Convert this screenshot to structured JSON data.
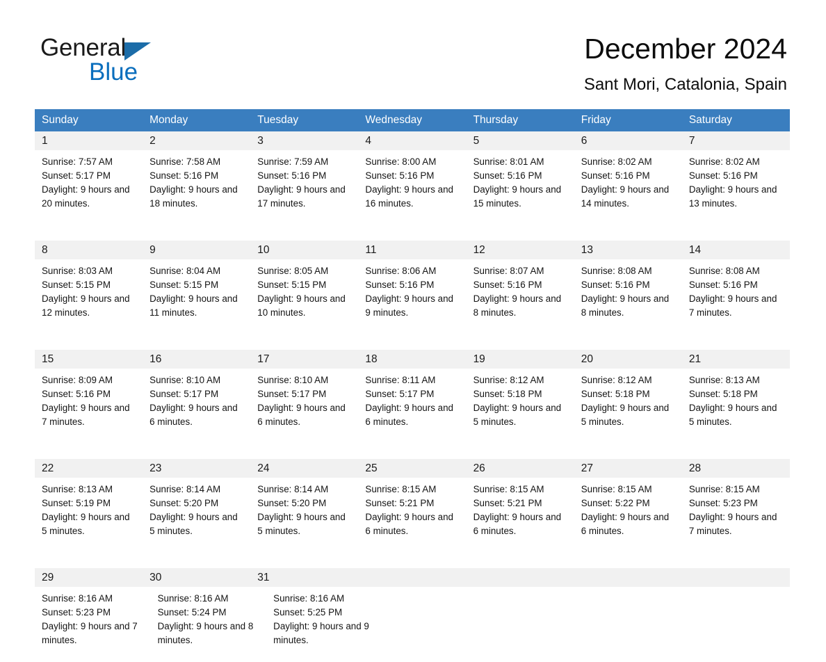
{
  "brand": {
    "line1": "General",
    "line2": "Blue",
    "triangle_color": "#1b6ca8",
    "blue_color": "#0a6ebd"
  },
  "header": {
    "title": "December 2024",
    "subtitle": "Sant Mori, Catalonia, Spain"
  },
  "theme": {
    "header_blue": "#3a7ebf",
    "daynum_gray": "#f1f1f1",
    "separator_blue": "#3a7ebf"
  },
  "weekdays": [
    "Sunday",
    "Monday",
    "Tuesday",
    "Wednesday",
    "Thursday",
    "Friday",
    "Saturday"
  ],
  "weeks": [
    {
      "days": [
        {
          "num": "1",
          "sunrise": "Sunrise: 7:57 AM",
          "sunset": "Sunset: 5:17 PM",
          "daylight": "Daylight: 9 hours and 20 minutes."
        },
        {
          "num": "2",
          "sunrise": "Sunrise: 7:58 AM",
          "sunset": "Sunset: 5:16 PM",
          "daylight": "Daylight: 9 hours and 18 minutes."
        },
        {
          "num": "3",
          "sunrise": "Sunrise: 7:59 AM",
          "sunset": "Sunset: 5:16 PM",
          "daylight": "Daylight: 9 hours and 17 minutes."
        },
        {
          "num": "4",
          "sunrise": "Sunrise: 8:00 AM",
          "sunset": "Sunset: 5:16 PM",
          "daylight": "Daylight: 9 hours and 16 minutes."
        },
        {
          "num": "5",
          "sunrise": "Sunrise: 8:01 AM",
          "sunset": "Sunset: 5:16 PM",
          "daylight": "Daylight: 9 hours and 15 minutes."
        },
        {
          "num": "6",
          "sunrise": "Sunrise: 8:02 AM",
          "sunset": "Sunset: 5:16 PM",
          "daylight": "Daylight: 9 hours and 14 minutes."
        },
        {
          "num": "7",
          "sunrise": "Sunrise: 8:02 AM",
          "sunset": "Sunset: 5:16 PM",
          "daylight": "Daylight: 9 hours and 13 minutes."
        }
      ]
    },
    {
      "days": [
        {
          "num": "8",
          "sunrise": "Sunrise: 8:03 AM",
          "sunset": "Sunset: 5:15 PM",
          "daylight": "Daylight: 9 hours and 12 minutes."
        },
        {
          "num": "9",
          "sunrise": "Sunrise: 8:04 AM",
          "sunset": "Sunset: 5:15 PM",
          "daylight": "Daylight: 9 hours and 11 minutes."
        },
        {
          "num": "10",
          "sunrise": "Sunrise: 8:05 AM",
          "sunset": "Sunset: 5:15 PM",
          "daylight": "Daylight: 9 hours and 10 minutes."
        },
        {
          "num": "11",
          "sunrise": "Sunrise: 8:06 AM",
          "sunset": "Sunset: 5:16 PM",
          "daylight": "Daylight: 9 hours and 9 minutes."
        },
        {
          "num": "12",
          "sunrise": "Sunrise: 8:07 AM",
          "sunset": "Sunset: 5:16 PM",
          "daylight": "Daylight: 9 hours and 8 minutes."
        },
        {
          "num": "13",
          "sunrise": "Sunrise: 8:08 AM",
          "sunset": "Sunset: 5:16 PM",
          "daylight": "Daylight: 9 hours and 8 minutes."
        },
        {
          "num": "14",
          "sunrise": "Sunrise: 8:08 AM",
          "sunset": "Sunset: 5:16 PM",
          "daylight": "Daylight: 9 hours and 7 minutes."
        }
      ]
    },
    {
      "days": [
        {
          "num": "15",
          "sunrise": "Sunrise: 8:09 AM",
          "sunset": "Sunset: 5:16 PM",
          "daylight": "Daylight: 9 hours and 7 minutes."
        },
        {
          "num": "16",
          "sunrise": "Sunrise: 8:10 AM",
          "sunset": "Sunset: 5:17 PM",
          "daylight": "Daylight: 9 hours and 6 minutes."
        },
        {
          "num": "17",
          "sunrise": "Sunrise: 8:10 AM",
          "sunset": "Sunset: 5:17 PM",
          "daylight": "Daylight: 9 hours and 6 minutes."
        },
        {
          "num": "18",
          "sunrise": "Sunrise: 8:11 AM",
          "sunset": "Sunset: 5:17 PM",
          "daylight": "Daylight: 9 hours and 6 minutes."
        },
        {
          "num": "19",
          "sunrise": "Sunrise: 8:12 AM",
          "sunset": "Sunset: 5:18 PM",
          "daylight": "Daylight: 9 hours and 5 minutes."
        },
        {
          "num": "20",
          "sunrise": "Sunrise: 8:12 AM",
          "sunset": "Sunset: 5:18 PM",
          "daylight": "Daylight: 9 hours and 5 minutes."
        },
        {
          "num": "21",
          "sunrise": "Sunrise: 8:13 AM",
          "sunset": "Sunset: 5:18 PM",
          "daylight": "Daylight: 9 hours and 5 minutes."
        }
      ]
    },
    {
      "days": [
        {
          "num": "22",
          "sunrise": "Sunrise: 8:13 AM",
          "sunset": "Sunset: 5:19 PM",
          "daylight": "Daylight: 9 hours and 5 minutes."
        },
        {
          "num": "23",
          "sunrise": "Sunrise: 8:14 AM",
          "sunset": "Sunset: 5:20 PM",
          "daylight": "Daylight: 9 hours and 5 minutes."
        },
        {
          "num": "24",
          "sunrise": "Sunrise: 8:14 AM",
          "sunset": "Sunset: 5:20 PM",
          "daylight": "Daylight: 9 hours and 5 minutes."
        },
        {
          "num": "25",
          "sunrise": "Sunrise: 8:15 AM",
          "sunset": "Sunset: 5:21 PM",
          "daylight": "Daylight: 9 hours and 6 minutes."
        },
        {
          "num": "26",
          "sunrise": "Sunrise: 8:15 AM",
          "sunset": "Sunset: 5:21 PM",
          "daylight": "Daylight: 9 hours and 6 minutes."
        },
        {
          "num": "27",
          "sunrise": "Sunrise: 8:15 AM",
          "sunset": "Sunset: 5:22 PM",
          "daylight": "Daylight: 9 hours and 6 minutes."
        },
        {
          "num": "28",
          "sunrise": "Sunrise: 8:15 AM",
          "sunset": "Sunset: 5:23 PM",
          "daylight": "Daylight: 9 hours and 7 minutes."
        }
      ]
    },
    {
      "days": [
        {
          "num": "29",
          "sunrise": "Sunrise: 8:16 AM",
          "sunset": "Sunset: 5:23 PM",
          "daylight": "Daylight: 9 hours and 7 minutes."
        },
        {
          "num": "30",
          "sunrise": "Sunrise: 8:16 AM",
          "sunset": "Sunset: 5:24 PM",
          "daylight": "Daylight: 9 hours and 8 minutes."
        },
        {
          "num": "31",
          "sunrise": "Sunrise: 8:16 AM",
          "sunset": "Sunset: 5:25 PM",
          "daylight": "Daylight: 9 hours and 9 minutes."
        },
        {
          "num": "",
          "sunrise": "",
          "sunset": "",
          "daylight": ""
        },
        {
          "num": "",
          "sunrise": "",
          "sunset": "",
          "daylight": ""
        },
        {
          "num": "",
          "sunrise": "",
          "sunset": "",
          "daylight": ""
        },
        {
          "num": "",
          "sunrise": "",
          "sunset": "",
          "daylight": ""
        }
      ]
    }
  ]
}
